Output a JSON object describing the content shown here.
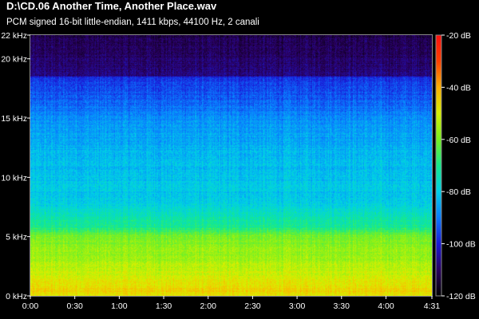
{
  "header": {
    "file_title": "D:\\CD.06 Another Time, Another Place.wav",
    "format_info": "PCM signed 16-bit little-endian, 1411 kbps, 44100 Hz, 2 canali"
  },
  "colors": {
    "background": "#000000",
    "colormap": [
      "#000000",
      "#2a0060",
      "#1a1ad8",
      "#0a7cff",
      "#00d0e8",
      "#14ea8c",
      "#78f020",
      "#d8f000",
      "#ffb000",
      "#ff4000",
      "#ff1010"
    ]
  },
  "chart_data": {
    "type": "heatmap",
    "title": "",
    "xlabel": "",
    "ylabel": "",
    "x_range": [
      0,
      271
    ],
    "y_range_khz": [
      0,
      22
    ],
    "x_ticks": [
      {
        "value": 0,
        "label": "0:00"
      },
      {
        "value": 30,
        "label": "0:30"
      },
      {
        "value": 60,
        "label": "1:00"
      },
      {
        "value": 90,
        "label": "1:30"
      },
      {
        "value": 120,
        "label": "2:00"
      },
      {
        "value": 150,
        "label": "2:30"
      },
      {
        "value": 180,
        "label": "3:00"
      },
      {
        "value": 210,
        "label": "3:30"
      },
      {
        "value": 240,
        "label": "4:00"
      },
      {
        "value": 271,
        "label": "4:31"
      }
    ],
    "y_ticks": [
      {
        "value": 0,
        "label": "0 kHz"
      },
      {
        "value": 5,
        "label": "5 kHz"
      },
      {
        "value": 10,
        "label": "10 kHz"
      },
      {
        "value": 15,
        "label": "15 kHz"
      },
      {
        "value": 20,
        "label": "20 kHz"
      },
      {
        "value": 22,
        "label": "22 kHz"
      }
    ],
    "colorbar": {
      "range_db": [
        -120,
        -20
      ],
      "ticks": [
        {
          "value": -20,
          "label": "-20 dB"
        },
        {
          "value": -40,
          "label": "-40 dB"
        },
        {
          "value": -60,
          "label": "-60 dB"
        },
        {
          "value": -80,
          "label": "-80 dB"
        },
        {
          "value": -100,
          "label": "-100 dB"
        },
        {
          "value": -120,
          "label": "-120 dB"
        }
      ]
    },
    "frequency_profile_db": [
      {
        "khz": 0,
        "db": -48
      },
      {
        "khz": 0.4,
        "db": -45
      },
      {
        "khz": 1.5,
        "db": -50
      },
      {
        "khz": 3,
        "db": -55
      },
      {
        "khz": 5,
        "db": -60
      },
      {
        "khz": 5.8,
        "db": -70
      },
      {
        "khz": 8,
        "db": -80
      },
      {
        "khz": 12,
        "db": -83
      },
      {
        "khz": 15,
        "db": -88
      },
      {
        "khz": 16,
        "db": -92
      },
      {
        "khz": 18.4,
        "db": -97
      },
      {
        "khz": 18.6,
        "db": -108
      },
      {
        "khz": 22,
        "db": -112
      }
    ]
  }
}
